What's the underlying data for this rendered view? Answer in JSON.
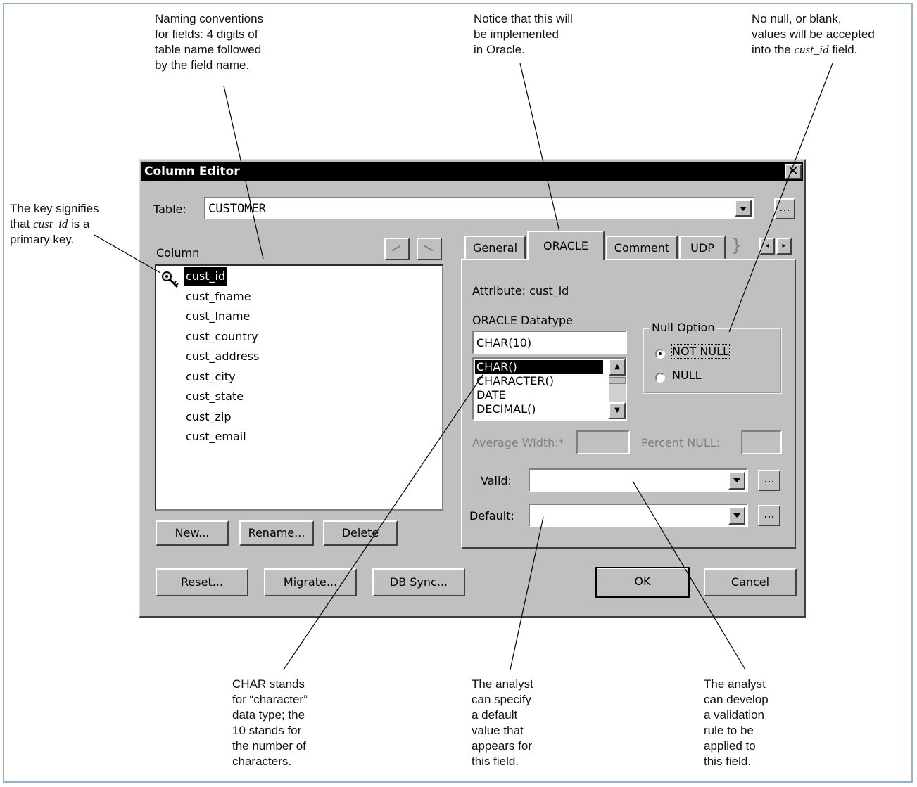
{
  "annotations": {
    "naming": "Naming conventions\nfor fields: 4 digits of\ntable name followed\nby the field name.",
    "oracle": "Notice that this will\nbe implemented\nin Oracle.",
    "nonull_pre": "No null, or blank,\nvalues will be accepted\ninto the ",
    "nonull_code": "cust_id",
    "nonull_post": " field.",
    "key_pre": "The key signifies\nthat ",
    "key_code": "cust_id",
    "key_post": " is a\nprimary key.",
    "char": "CHAR stands\nfor “character”\ndata type; the\n10 stands for\nthe number of\ncharacters.",
    "default": "The analyst\ncan specify\na default\nvalue that\nappears for\nthis field.",
    "valid": "The analyst\ncan develop\na validation\nrule to be\napplied to\nthis field."
  },
  "dialog": {
    "title": "Column Editor",
    "close_glyph": "✕",
    "table_label": "Table:",
    "table_value": "CUSTOMER",
    "ellipsis": "...",
    "column_label": "Column",
    "columns": [
      "cust_id",
      "cust_fname",
      "cust_lname",
      "cust_country",
      "cust_address",
      "cust_city",
      "cust_state",
      "cust_zip",
      "cust_email"
    ],
    "selected_column": "cust_id",
    "buttons": {
      "new": "New...",
      "rename": "Rename...",
      "delete": "Delete",
      "reset": "Reset...",
      "migrate": "Migrate...",
      "dbsync": "DB Sync...",
      "ok": "OK",
      "cancel": "Cancel"
    },
    "tabs": [
      "General",
      "ORACLE",
      "Comment",
      "UDP"
    ],
    "active_tab": "ORACLE",
    "attribute_label": "Attribute:",
    "attribute_value": "cust_id",
    "datatype_label": "ORACLE Datatype",
    "datatype_value": "CHAR(10)",
    "datatype_options": [
      "CHAR()",
      "CHARACTER()",
      "DATE",
      "DECIMAL()"
    ],
    "null_option_label": "Null Option",
    "null_options": [
      "NOT NULL",
      "NULL"
    ],
    "null_selected": "NOT NULL",
    "avg_width_label": "Average Width:*",
    "percent_null_label": "Percent NULL:",
    "valid_label": "Valid:",
    "default_label": "Default:"
  },
  "icons": {
    "key": "key-icon",
    "up_arrow": "arrow-up-icon",
    "down_arrow": "arrow-down-icon"
  }
}
